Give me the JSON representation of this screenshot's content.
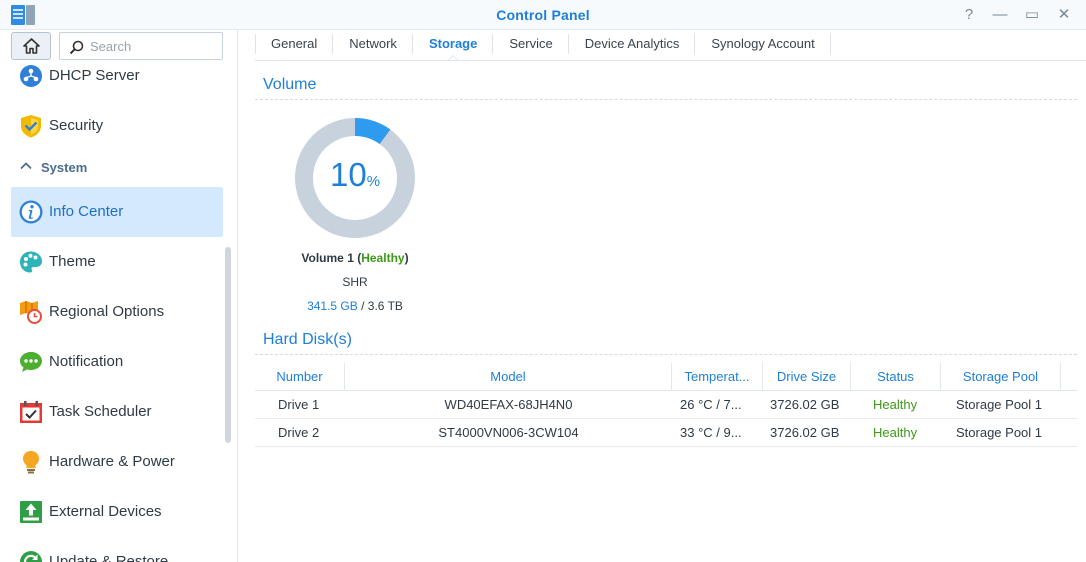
{
  "window": {
    "title": "Control Panel",
    "controls": [
      "?",
      "—",
      "▭",
      "✕"
    ]
  },
  "sidebar": {
    "search_placeholder": "Search",
    "items": [
      {
        "label": "DHCP Server",
        "icon": "dhcp-icon"
      },
      {
        "label": "Security",
        "icon": "shield-icon"
      }
    ],
    "section": {
      "label": "System",
      "icon": "chevron-up-icon"
    },
    "system_items": [
      {
        "label": "Info Center",
        "icon": "info-icon",
        "active": true
      },
      {
        "label": "Theme",
        "icon": "palette-icon"
      },
      {
        "label": "Regional Options",
        "icon": "map-clock-icon"
      },
      {
        "label": "Notification",
        "icon": "chat-bubble-icon"
      },
      {
        "label": "Task Scheduler",
        "icon": "calendar-check-icon"
      },
      {
        "label": "Hardware & Power",
        "icon": "lightbulb-icon"
      },
      {
        "label": "External Devices",
        "icon": "upload-device-icon"
      },
      {
        "label": "Update & Restore",
        "icon": "update-icon"
      }
    ]
  },
  "tabs": [
    "General",
    "Network",
    "Storage",
    "Service",
    "Device Analytics",
    "Synology Account"
  ],
  "active_tab": "Storage",
  "volume": {
    "section_title": "Volume",
    "percent_used": 10,
    "percent_label": "10",
    "percent_symbol": "%",
    "name": "Volume 1",
    "status": "Healthy",
    "raid_type": "SHR",
    "used": "341.5 GB",
    "separator": " / ",
    "total": "3.6 TB"
  },
  "hard_disks": {
    "section_title": "Hard Disk(s)",
    "columns": [
      "Number",
      "Model",
      "Temperat...",
      "Drive Size",
      "Status",
      "Storage Pool"
    ],
    "rows": [
      {
        "number": "Drive 1",
        "model": "WD40EFAX-68JH4N0",
        "temperature": "26 °C / 7...",
        "size": "3726.02 GB",
        "status": "Healthy",
        "pool": "Storage Pool 1"
      },
      {
        "number": "Drive 2",
        "model": "ST4000VN006-3CW104",
        "temperature": "33 °C / 9...",
        "size": "3726.02 GB",
        "status": "Healthy",
        "pool": "Storage Pool 1"
      }
    ]
  },
  "colors": {
    "accent": "#1e7fd8",
    "healthy": "#3c9a17",
    "donut_used": "#2e9bef",
    "donut_free": "#c8d2dc",
    "active_bg": "#d4e9fb"
  }
}
